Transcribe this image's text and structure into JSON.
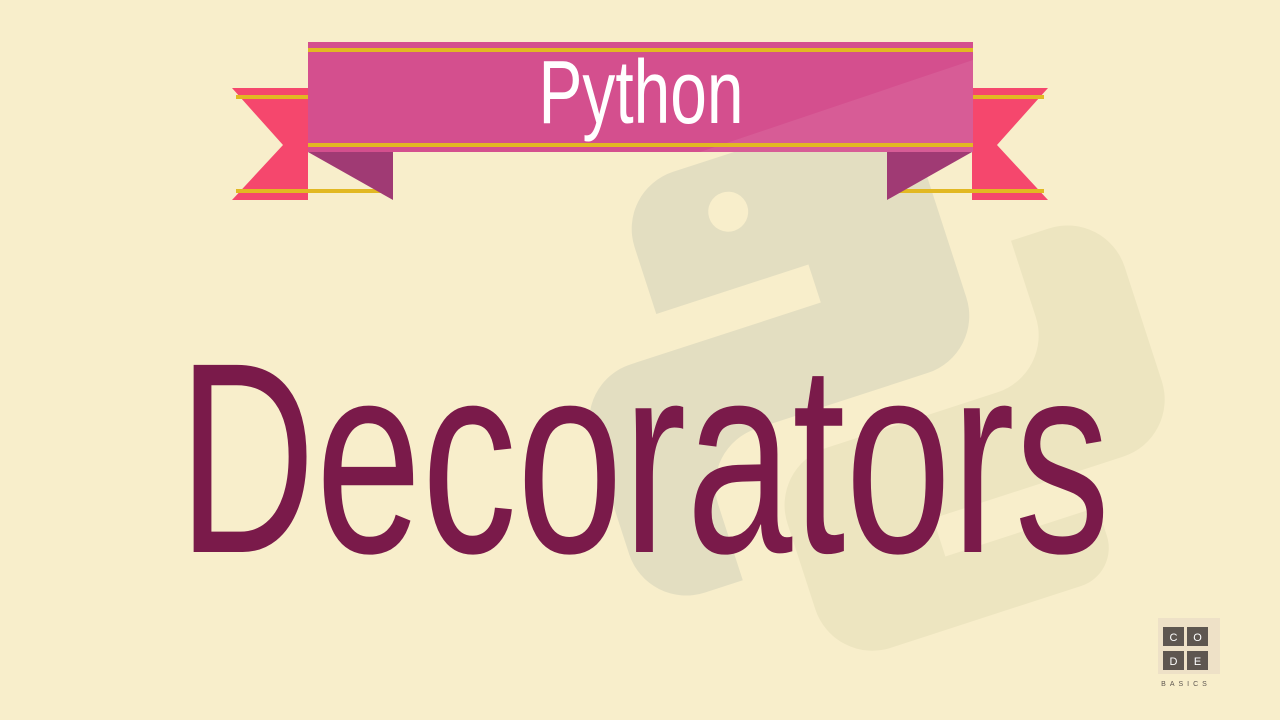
{
  "banner": {
    "label": "Python"
  },
  "title": "Decorators",
  "logo": {
    "top_row": [
      "C",
      "O"
    ],
    "bottom_row": [
      "D",
      "E"
    ],
    "subtitle": "BASICS"
  },
  "colors": {
    "background": "#f8eecb",
    "title": "#7a1a4a",
    "banner": "#d44f8e",
    "tail": "#f5476d",
    "fold": "#a03a74",
    "stripe": "#e2b822",
    "watermark": "#e4dfc2"
  }
}
